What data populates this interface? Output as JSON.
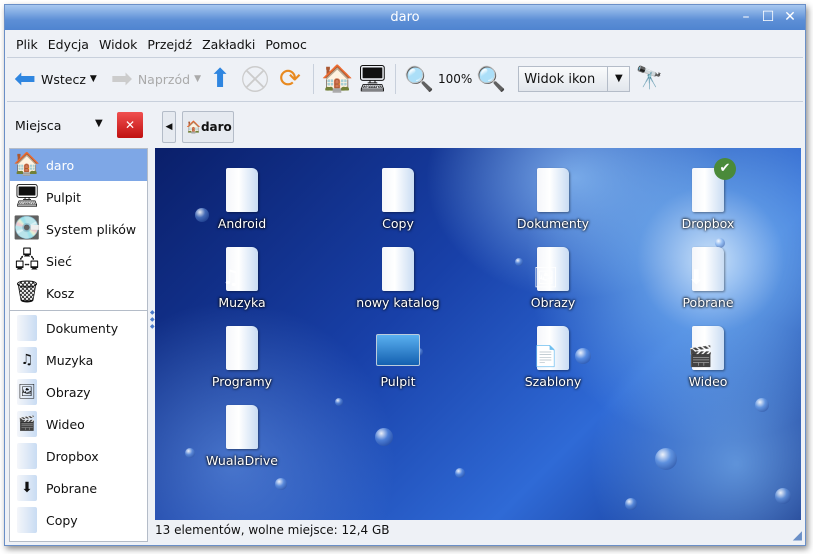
{
  "window": {
    "title": "daro"
  },
  "menu": [
    "Plik",
    "Edycja",
    "Widok",
    "Przejdź",
    "Zakładki",
    "Pomoc"
  ],
  "toolbar": {
    "back": "Wstecz",
    "forward": "Naprzód",
    "zoom": "100%",
    "view_mode": "Widok ikon"
  },
  "location": {
    "places_label": "Miejsca",
    "crumb": "daro"
  },
  "sidebar": {
    "places": [
      {
        "label": "daro",
        "icon": "home-icon",
        "glyph": "🏠",
        "selected": true
      },
      {
        "label": "Pulpit",
        "icon": "desktop-icon",
        "glyph": "🖥"
      },
      {
        "label": "System plików",
        "icon": "harddisk-icon",
        "glyph": "💽"
      },
      {
        "label": "Sieć",
        "icon": "network-icon",
        "glyph": "🖧"
      },
      {
        "label": "Kosz",
        "icon": "trash-icon",
        "glyph": "🗑"
      }
    ],
    "bookmarks": [
      {
        "label": "Dokumenty",
        "icon": "folder-documents-icon",
        "glyph": ""
      },
      {
        "label": "Muzyka",
        "icon": "folder-music-icon",
        "glyph": "♫"
      },
      {
        "label": "Obrazy",
        "icon": "folder-pictures-icon",
        "glyph": "🖼"
      },
      {
        "label": "Wideo",
        "icon": "folder-video-icon",
        "glyph": "🎬"
      },
      {
        "label": "Dropbox",
        "icon": "folder-dropbox-icon",
        "glyph": ""
      },
      {
        "label": "Pobrane",
        "icon": "folder-downloads-icon",
        "glyph": "⬇"
      },
      {
        "label": "Copy",
        "icon": "folder-icon",
        "glyph": ""
      }
    ]
  },
  "files": [
    {
      "label": "Android",
      "glyph": ""
    },
    {
      "label": "Copy",
      "glyph": ""
    },
    {
      "label": "Dokumenty",
      "glyph": ""
    },
    {
      "label": "Dropbox",
      "glyph": "✔"
    },
    {
      "label": "Muzyka",
      "glyph": "♫"
    },
    {
      "label": "nowy katalog",
      "glyph": ""
    },
    {
      "label": "Obrazy",
      "glyph": "🖼"
    },
    {
      "label": "Pobrane",
      "glyph": "⬇"
    },
    {
      "label": "Programy",
      "glyph": ""
    },
    {
      "label": "Pulpit",
      "glyph": "desk"
    },
    {
      "label": "Szablony",
      "glyph": "📄"
    },
    {
      "label": "Wideo",
      "glyph": "🎬"
    },
    {
      "label": "WualaDrive",
      "glyph": ""
    }
  ],
  "status": "13 elementów, wolne miejsce: 12,4 GB"
}
